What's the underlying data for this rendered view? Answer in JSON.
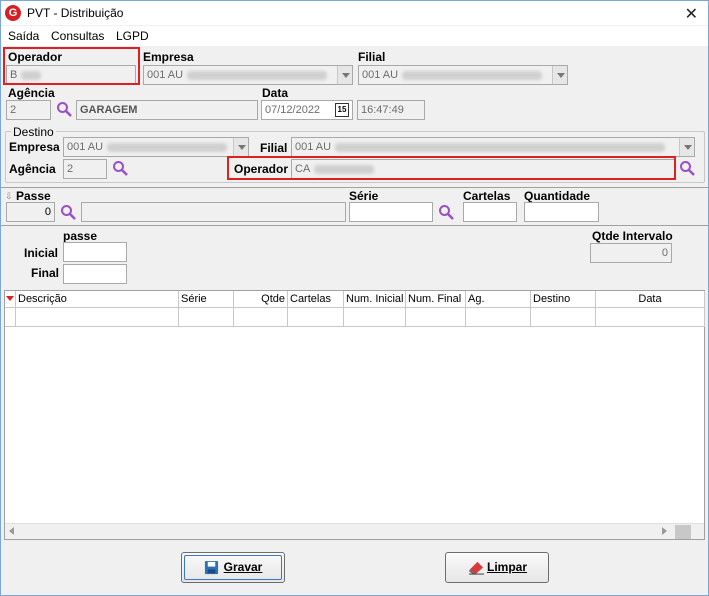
{
  "window": {
    "title": "PVT - Distribuição",
    "logo": "G"
  },
  "menu": [
    "Saída",
    "Consultas",
    "LGPD"
  ],
  "origem": {
    "operador_label": "Operador",
    "operador_value": "B",
    "empresa_label": "Empresa",
    "empresa_value": "001 AU",
    "filial_label": "Filial",
    "filial_value": "001 AU",
    "agencia_label": "Agência",
    "agencia_code": "2",
    "agencia_name": "GARAGEM",
    "data_label": "Data",
    "data_value": "07/12/2022",
    "calendar_day": "15",
    "hora_value": "16:47:49"
  },
  "destino": {
    "group_label": "Destino",
    "empresa_label": "Empresa",
    "empresa_value": "001 AU",
    "filial_label": "Filial",
    "filial_value": "001 AU",
    "agencia_label": "Agência",
    "agencia_code": "2",
    "operador_label": "Operador",
    "operador_value": "CA"
  },
  "passe": {
    "passe_label": "Passe",
    "passe_value": "0",
    "serie_label": "Série",
    "cartelas_label": "Cartelas",
    "quantidade_label": "Quantidade"
  },
  "intervalo": {
    "header": "passe",
    "inicial_label": "Inicial",
    "final_label": "Final",
    "qtde_label": "Qtde Intervalo",
    "qtde_value": "0"
  },
  "grid": {
    "columns": [
      "Descrição",
      "Série",
      "Qtde",
      "Cartelas",
      "Num. Inicial",
      "Num. Final",
      "Ag.",
      "Destino",
      "Data"
    ]
  },
  "buttons": {
    "gravar": "Gravar",
    "limpar": "Limpar"
  },
  "colors": {
    "highlight": "#e02020",
    "brand": "#d71f26"
  }
}
